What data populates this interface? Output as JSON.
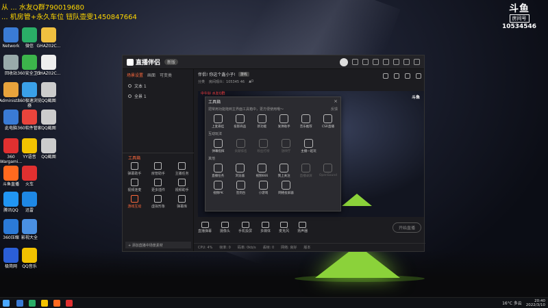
{
  "watermark": {
    "line1": "从 ... 水友Q群790019680",
    "line2": "... 机房管+永久车位 钮队壶雯1450847664"
  },
  "douyu": {
    "mark": "斗鱼",
    "sub": "房间号",
    "room_id": "10534546"
  },
  "desktop_icons": [
    {
      "label": "Network",
      "color": "#3a7bd5"
    },
    {
      "label": "微信",
      "color": "#2aae67"
    },
    {
      "label": "GHAZ02C...",
      "color": "#f0c040"
    },
    {
      "label": "回收站",
      "color": "#9aa"
    },
    {
      "label": "360安全卫士",
      "color": "#3cb44b"
    },
    {
      "label": "GHAZ02C...",
      "color": "#eee"
    },
    {
      "label": "Administr...",
      "color": "#e8a33c"
    },
    {
      "label": "360极速浏览器",
      "color": "#3aa0e8"
    },
    {
      "label": "QQ截图",
      "color": "#ccc"
    },
    {
      "label": "此电脑",
      "color": "#3a7bd5"
    },
    {
      "label": "360软件管家",
      "color": "#e9443c"
    },
    {
      "label": "QQ截图",
      "color": "#ccc"
    },
    {
      "label": "360 Wargami...",
      "color": "#e03030"
    },
    {
      "label": "YY语音",
      "color": "#f2c200"
    },
    {
      "label": "QQ截图",
      "color": "#ccc"
    },
    {
      "label": "斗鱼直播",
      "color": "#ff6a1f"
    },
    {
      "label": "火车",
      "color": "#e03030"
    },
    {
      "label": "腾讯QQ",
      "color": "#2196f3"
    },
    {
      "label": "迅雷",
      "color": "#1e88e5"
    },
    {
      "label": "360压缩",
      "color": "#2b7ad8"
    },
    {
      "label": "影视大全",
      "color": "#4a90e2"
    },
    {
      "label": "极简网",
      "color": "#2b5fd8"
    },
    {
      "label": "QQ音乐",
      "color": "#f2c200"
    }
  ],
  "app": {
    "name": "直播伴侣",
    "version": "新版",
    "tabs": [
      "场景设置",
      "画面",
      "可变类"
    ],
    "layers": [
      "文本 1",
      "全景 1"
    ],
    "toolbox_head": "工具箱",
    "toolbox_items": [
      {
        "label": "弹幕助手",
        "hot": false
      },
      {
        "label": "房管助手",
        "hot": false
      },
      {
        "label": "主播任务",
        "hot": false
      },
      {
        "label": "视频连麦",
        "hot": false
      },
      {
        "label": "更多插件",
        "hot": false
      },
      {
        "label": "视频助手",
        "hot": false
      },
      {
        "label": "游戏互动",
        "hot": true
      },
      {
        "label": "虚拟形象",
        "hot": false
      },
      {
        "label": "弹幕库",
        "hot": false
      }
    ],
    "scene_add": "+ 添加直播中场景素材",
    "room_title": "伴侣! 你这个鑫小子!",
    "room_tag": "游戏",
    "room_meta": [
      "分类",
      "房间观众：105345 46",
      "▲0"
    ],
    "preview_logo": "斗鱼",
    "preview_chat": "中午好 水友Q群",
    "bottom_items": [
      "直播弹幕",
      "摄像头",
      "手机投屏",
      "多媒体",
      "麦克风",
      "扬声器"
    ],
    "start_live": "开始直播",
    "status": [
      "CPU: 4%",
      "帧率: 0",
      "码率: 0kb/s",
      "丢帧: 0",
      "网络: 良好",
      "版本"
    ]
  },
  "dialog": {
    "title": "工具箱",
    "close": "×",
    "desc": "把常用功能拖到主界面工具箱中，更方便使用哦～",
    "feedback": "反馈",
    "row1": [
      {
        "label": "上麦悬挂",
        "dim": false
      },
      {
        "label": "投影商品",
        "dim": false
      },
      {
        "label": "新功能",
        "dim": false
      },
      {
        "label": "发弹助手",
        "dim": false
      },
      {
        "label": "音乐推荐",
        "dim": false
      },
      {
        "label": "CSR直播",
        "dim": false
      }
    ],
    "sec_interact": "互动玩法",
    "row2": [
      {
        "label": "弹幕指挥",
        "dim": false
      },
      {
        "label": "贡献排名",
        "dim": true
      },
      {
        "label": "粉丝打榜",
        "dim": true
      },
      {
        "label": "放映厅",
        "dim": true
      },
      {
        "label": "主播一起玩",
        "dim": false
      }
    ],
    "sec_other": "其他",
    "row3": [
      {
        "label": "直播任务",
        "dim": false
      },
      {
        "label": "浏览器",
        "dim": false
      },
      {
        "label": "视频666",
        "dim": false
      },
      {
        "label": "我上关注",
        "dim": false
      },
      {
        "label": "直播录屏",
        "dim": true
      },
      {
        "label": "OpenSound",
        "dim": true
      }
    ],
    "row4": [
      {
        "label": "视频PK",
        "dim": false
      },
      {
        "label": "签到台",
        "dim": false
      },
      {
        "label": "小游戏",
        "dim": false
      },
      {
        "label": "网络投屏器",
        "dim": false
      }
    ]
  },
  "taskbar": {
    "weather": "16°C 多云",
    "time": "20:40",
    "date": "2022/3/10",
    "apps": [
      "#3a7bd5",
      "#2aae67",
      "#f2c200",
      "#ff6a1f",
      "#e03030"
    ]
  }
}
